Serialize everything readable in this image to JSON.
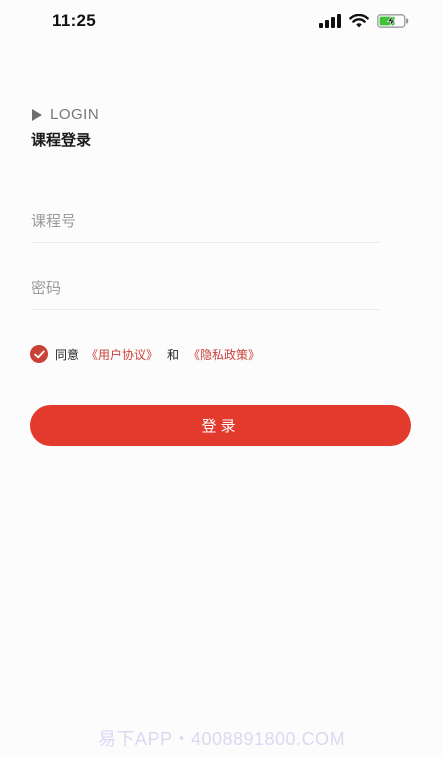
{
  "status_bar": {
    "time": "11:25",
    "icons": [
      "signal-icon",
      "wifi-icon",
      "battery-charging-icon"
    ]
  },
  "header": {
    "tag": "LOGIN",
    "title": "课程登录"
  },
  "form": {
    "course_number": {
      "placeholder": "课程号",
      "value": ""
    },
    "password": {
      "placeholder": "密码",
      "value": ""
    }
  },
  "agreement": {
    "checked": true,
    "prefix": "同意",
    "user_agreement": "《用户协议》",
    "and": "和",
    "privacy_policy": "《隐私政策》"
  },
  "login_button": {
    "label": "登录"
  },
  "watermark": "易下APP・4008891800.COM",
  "colors": {
    "accent": "#e23a2c",
    "link": "#c9413a",
    "checkbox": "#c94137",
    "watermark": "#d9d9f2"
  }
}
